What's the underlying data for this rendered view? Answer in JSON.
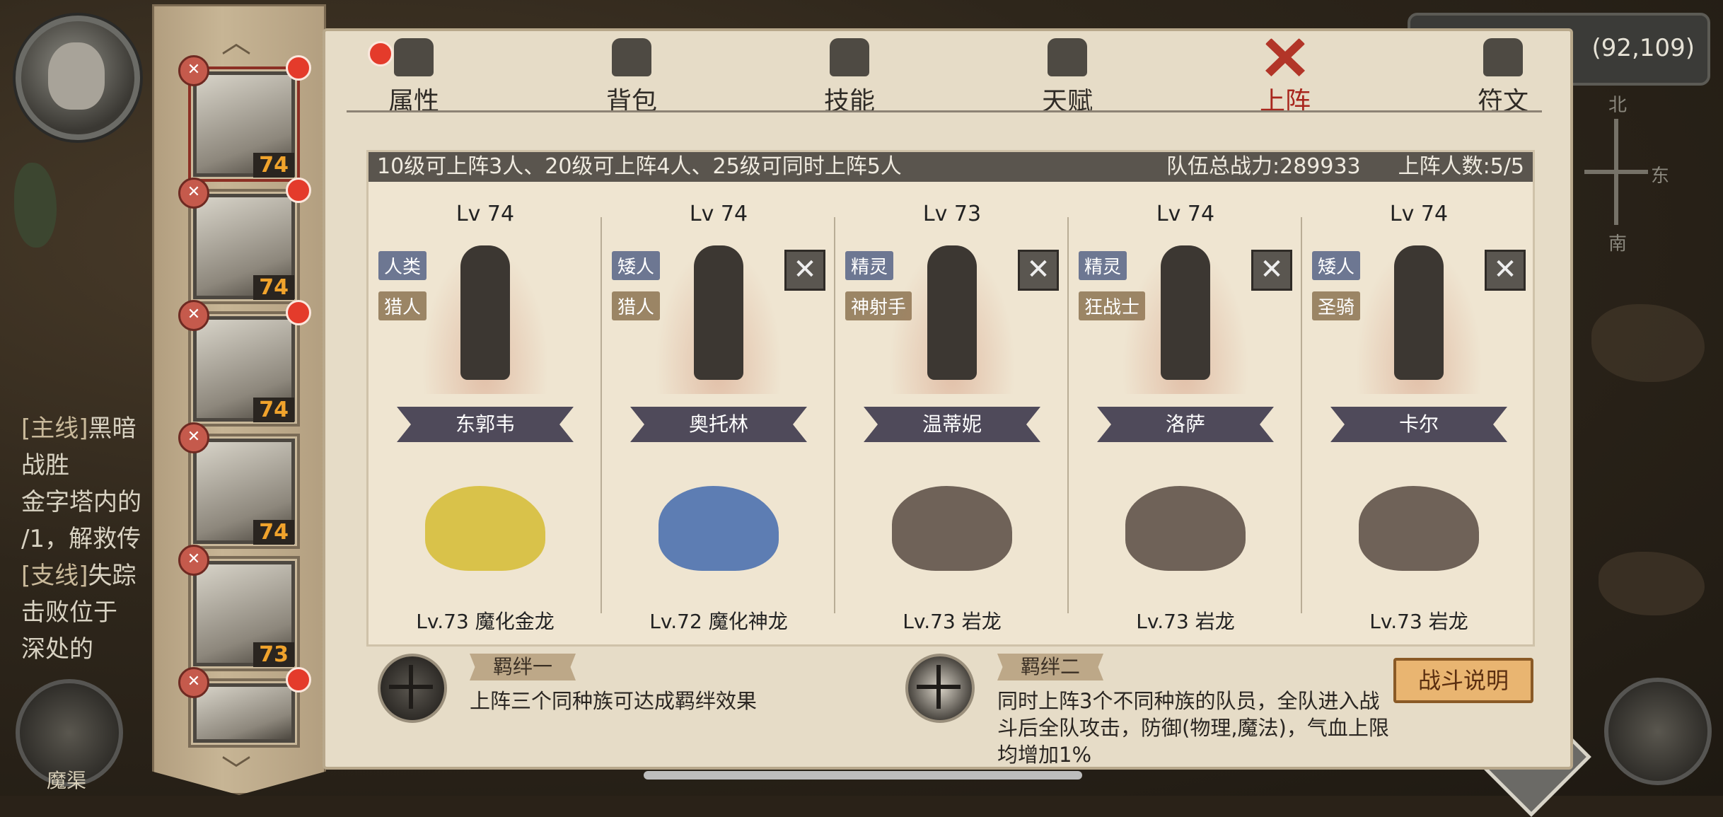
{
  "coordinates": "(92,109)",
  "compass": {
    "north": "北",
    "east": "东",
    "south": "南"
  },
  "quests": [
    {
      "tag": "[主线]",
      "title": "黑暗",
      "lines": [
        "战胜",
        "金字塔内的",
        "/1，解救传"
      ]
    },
    {
      "tag": "[支线]",
      "title": "失踪",
      "lines": [
        "击败位于",
        "深处的"
      ]
    }
  ],
  "left_round_label": "魔渠",
  "hero_column": {
    "heroes": [
      {
        "level": "74",
        "badge": "✕",
        "selected": true
      },
      {
        "level": "74",
        "badge": "✕",
        "selected": false
      },
      {
        "level": "74",
        "badge": "✕",
        "selected": false
      },
      {
        "level": "74",
        "badge": "✕",
        "selected": false
      },
      {
        "level": "73",
        "badge": "✕",
        "selected": false
      },
      {
        "level": "",
        "badge": "✕",
        "selected": false
      }
    ]
  },
  "tabs": [
    {
      "label": "属性",
      "icon": "fire-icon",
      "notice": true,
      "active": false
    },
    {
      "label": "背包",
      "icon": "bag-icon",
      "notice": false,
      "active": false
    },
    {
      "label": "技能",
      "icon": "book-icon",
      "notice": false,
      "active": false
    },
    {
      "label": "天赋",
      "icon": "eye-icon",
      "notice": false,
      "active": false
    },
    {
      "label": "上阵",
      "icon": "crossed-swords-icon",
      "notice": false,
      "active": true
    },
    {
      "label": "符文",
      "icon": "rune-icon",
      "notice": false,
      "active": false
    }
  ],
  "formation": {
    "rule_text": "10级可上阵3人、20级可上阵4人、25级可同时上阵5人",
    "team_power": "队伍总战力:289933",
    "deploy_count": "上阵人数:5/5",
    "slots": [
      {
        "level": "Lv 74",
        "race": "人类",
        "class": "猎人",
        "name": "东郭韦",
        "pet": "Lv.73 魔化金龙",
        "removable": false,
        "pet_color": "#d9c24a"
      },
      {
        "level": "Lv 74",
        "race": "矮人",
        "class": "猎人",
        "name": "奥托林",
        "pet": "Lv.72 魔化神龙",
        "removable": true,
        "pet_color": "#5d7db3"
      },
      {
        "level": "Lv 73",
        "race": "精灵",
        "class": "神射手",
        "name": "温蒂妮",
        "pet": "Lv.73 岩龙",
        "removable": true,
        "pet_color": "#6f6258"
      },
      {
        "level": "Lv 74",
        "race": "精灵",
        "class": "狂战士",
        "name": "洛萨",
        "pet": "Lv.73 岩龙",
        "removable": true,
        "pet_color": "#6f6258"
      },
      {
        "level": "Lv 74",
        "race": "矮人",
        "class": "圣骑",
        "name": "卡尔",
        "pet": "Lv.73 岩龙",
        "removable": true,
        "pet_color": "#6f6258"
      }
    ]
  },
  "bonds": [
    {
      "title": "羁绊一",
      "desc": "上阵三个同种族可达成羁绊效果"
    },
    {
      "title": "羁绊二",
      "desc": "同时上阵3个不同种族的队员，全队进入战斗后全队攻击，防御(物理,魔法)，气血上限均增加1%"
    }
  ],
  "battle_info_button": "战斗说明",
  "colors": {
    "active_tab": "#a8261d",
    "level_text": "#f0a32c",
    "notice_dot": "#e43b2b",
    "panel": "#e6dcc7"
  }
}
